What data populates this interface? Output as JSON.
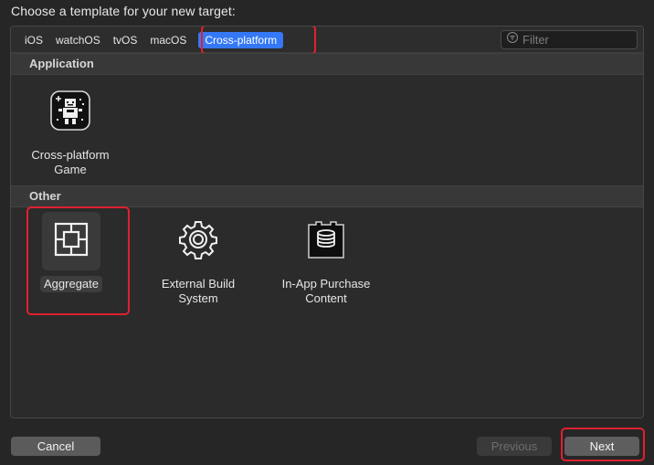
{
  "header": {
    "title": "Choose a template for your new target:"
  },
  "tabs": [
    {
      "label": "iOS"
    },
    {
      "label": "watchOS"
    },
    {
      "label": "tvOS"
    },
    {
      "label": "macOS"
    },
    {
      "label": "Cross-platform"
    }
  ],
  "active_tab": "Cross-platform",
  "filter": {
    "placeholder": "Filter",
    "value": "",
    "icon": "filter-icon"
  },
  "sections": [
    {
      "title": "Application",
      "items": [
        {
          "label": "Cross-platform Game",
          "icon": "game-robot-icon"
        }
      ]
    },
    {
      "title": "Other",
      "items": [
        {
          "label": "Aggregate",
          "icon": "aggregate-icon",
          "selected": true
        },
        {
          "label": "External Build System",
          "icon": "gear-icon"
        },
        {
          "label": "In-App Purchase Content",
          "icon": "in-app-purchase-icon"
        }
      ]
    }
  ],
  "footer": {
    "cancel_label": "Cancel",
    "previous_label": "Previous",
    "next_label": "Next"
  },
  "colors": {
    "accent": "#3478f6",
    "highlight": "#e0202f",
    "background": "#262626"
  }
}
